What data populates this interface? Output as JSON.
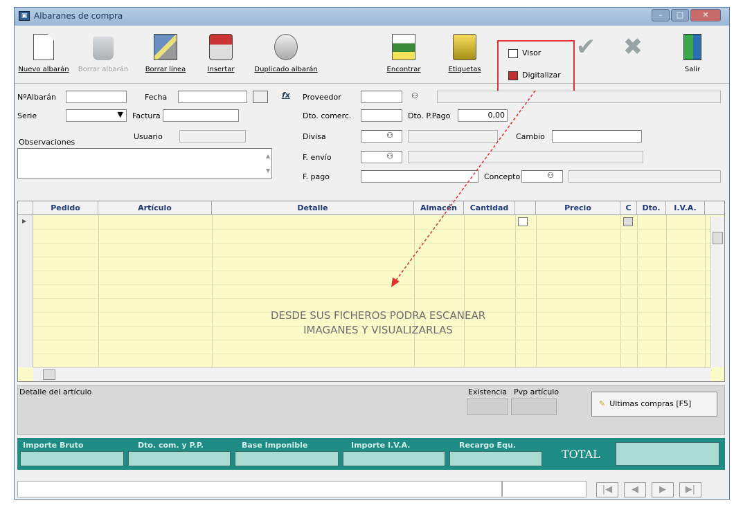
{
  "window": {
    "title": "Albaranes de compra"
  },
  "toolbar": {
    "buttons": [
      {
        "label": "Nuevo albarán",
        "icon": "new-document-icon",
        "enabled": true
      },
      {
        "label": "Borrar albarán",
        "icon": "trash-icon",
        "enabled": false
      },
      {
        "label": "Borrar línea",
        "icon": "edit-line-icon",
        "enabled": true
      },
      {
        "label": "Insertar",
        "icon": "insert-icon",
        "enabled": true
      },
      {
        "label": "Duplicado albarán",
        "icon": "duplicate-icon",
        "enabled": true
      },
      {
        "label": "Encontrar",
        "icon": "find-icon",
        "enabled": true
      },
      {
        "label": "Etiquetas",
        "icon": "labels-icon",
        "enabled": true
      }
    ],
    "visor": "Visor",
    "digitalizar": "Digitalizar",
    "salir": "Salir"
  },
  "form": {
    "nalbaran_label": "NºAlbarán",
    "fecha_label": "Fecha",
    "serie_label": "Serie",
    "factura_label": "Factura",
    "usuario_label": "Usuario",
    "observaciones_label": "Observaciones",
    "proveedor_label": "Proveedor",
    "dto_comerc_label": "Dto. comerc.",
    "dto_ppago_label": "Dto. P.Pago",
    "dto_ppago_value": "0,00",
    "divisa_label": "Divisa",
    "cambio_label": "Cambio",
    "f_envio_label": "F. envío",
    "f_pago_label": "F. pago",
    "concepto_label": "Concepto"
  },
  "grid": {
    "columns": [
      "Pedido",
      "Artículo",
      "Detalle",
      "Almacén",
      "Cantidad",
      "",
      "Precio",
      "C",
      "Dto.",
      "I.V.A."
    ],
    "message_line1": "DESDE SUS FICHEROS PODRA ESCANEAR",
    "message_line2": "IMAGANES Y VISUALIZARLAS"
  },
  "details": {
    "detalle_label": "Detalle del artículo",
    "existencia_label": "Existencia",
    "pvp_label": "Pvp artículo",
    "ultimas_compras": "Ultimas compras [F5]"
  },
  "totals": {
    "importe_bruto": "Importe Bruto",
    "dto_com": "Dto. com. y P.P.",
    "base_imponible": "Base Imponible",
    "importe_iva": "Importe I.V.A.",
    "recargo": "Recargo Equ.",
    "total": "TOTAL"
  },
  "colors": {
    "accent_red": "#e03030",
    "teal": "#1e8c84",
    "grid_yellow": "#fbfbc9",
    "header_blue": "#1f3a78"
  }
}
